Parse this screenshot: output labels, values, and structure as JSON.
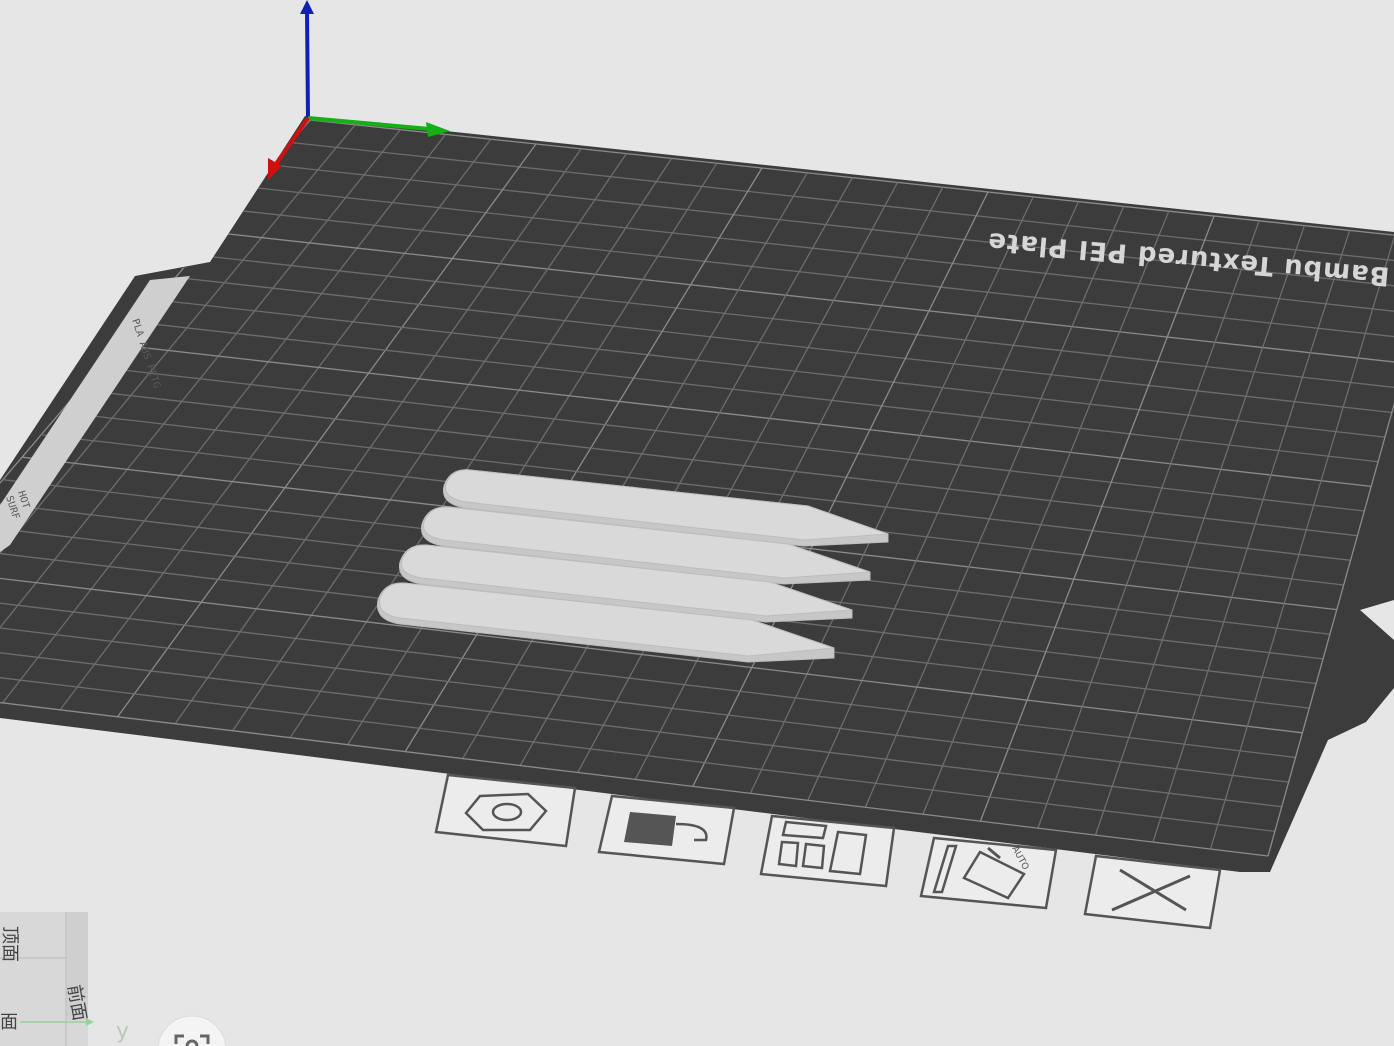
{
  "plate": {
    "name": "Bambu Textured PEI Plate",
    "side_label": "PLA ABS PETG",
    "side_label_2": "HOT",
    "side_label_3": "SURF"
  },
  "plate_toolbar": {
    "buttons": [
      {
        "name": "plate-settings-button",
        "icon": "hexagon-nut-icon"
      },
      {
        "name": "lock-plate-button",
        "icon": "lock-icon"
      },
      {
        "name": "arrange-button",
        "icon": "arrange-icon"
      },
      {
        "name": "auto-orient-button",
        "icon": "auto-orient-icon",
        "badge": "AUTO"
      },
      {
        "name": "delete-plate-button",
        "icon": "close-icon"
      }
    ]
  },
  "view_cube": {
    "top_face": "顶面",
    "front_face": "面",
    "right_face": "前面"
  },
  "axis_label_y": "y",
  "colors": {
    "background": "#e6e6e6",
    "plate": "#3b3c3b",
    "grid": "#6c6e6c",
    "model": "#d9d9d9",
    "axis_x": "#d01010",
    "axis_y": "#14b014",
    "axis_z": "#1020b0"
  }
}
